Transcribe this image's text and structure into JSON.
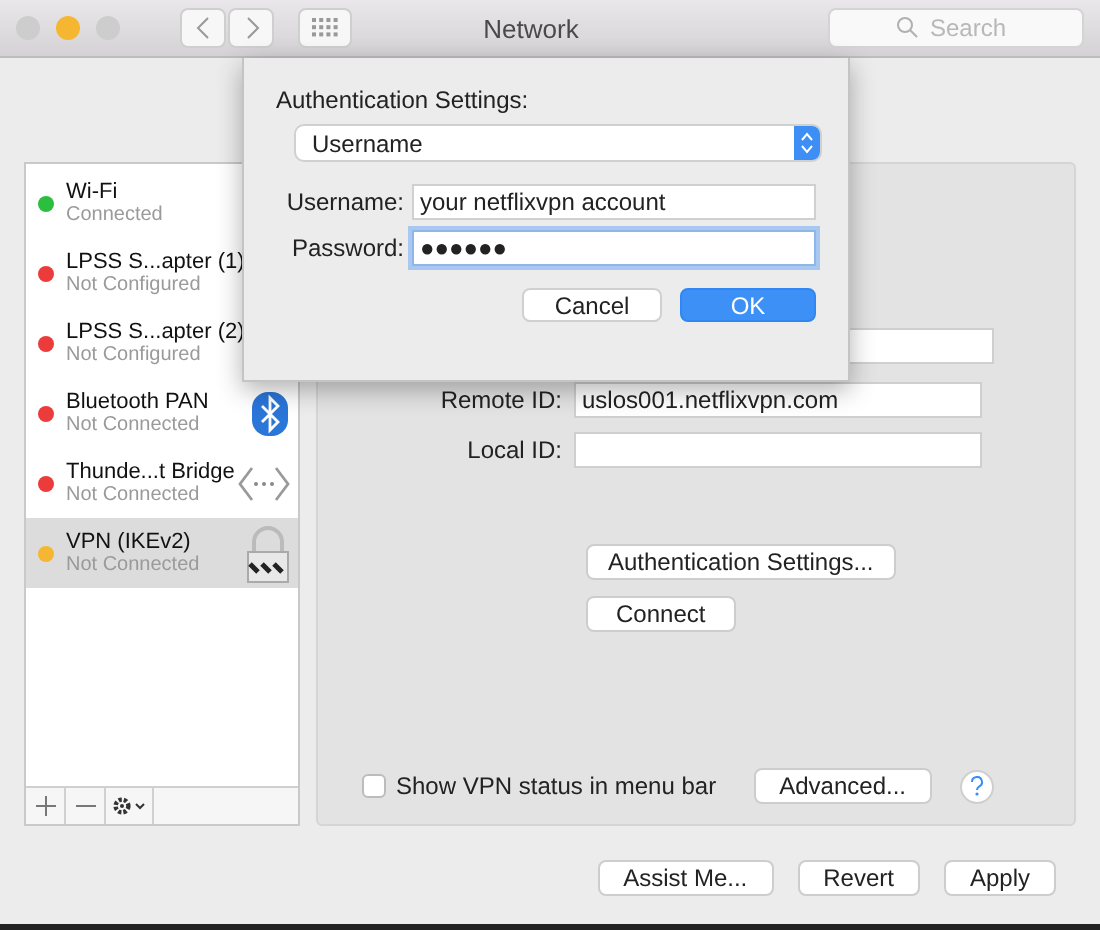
{
  "window": {
    "title": "Network",
    "controls": [
      {
        "color": "#cdcdcd"
      },
      {
        "color": "#f5b731"
      },
      {
        "color": "#cdcdcd"
      }
    ]
  },
  "toolbar": {
    "search": {
      "placeholder": "Search"
    }
  },
  "sidebar": {
    "items": [
      {
        "name": "Wi-Fi",
        "status": "Connected",
        "color": "#2dbd3f",
        "selected": false,
        "kind": "plain"
      },
      {
        "name": "LPSS S...apter (1)",
        "status": "Not Configured",
        "color": "#ec3b3b",
        "selected": false,
        "kind": "plain"
      },
      {
        "name": "LPSS S...apter (2)",
        "status": "Not Configured",
        "color": "#ec3b3b",
        "selected": false,
        "kind": "plain"
      },
      {
        "name": "Bluetooth PAN",
        "status": "Not Connected",
        "color": "#ec3b3b",
        "selected": false,
        "kind": "bluetooth"
      },
      {
        "name": "Thunde...t Bridge",
        "status": "Not Connected",
        "color": "#ec3b3b",
        "selected": false,
        "kind": "bridge"
      },
      {
        "name": "VPN (IKEv2)",
        "status": "Not Connected",
        "color": "#f5b731",
        "selected": true,
        "kind": "vpn"
      }
    ]
  },
  "details": {
    "fields": [
      {
        "label": "Remote ID:",
        "value": "uslos001.netflixvpn.com"
      },
      {
        "label": "Local ID:"
      }
    ],
    "buttons": [
      "Authentication Settings...",
      "Connect"
    ],
    "show_status": {
      "label": "Show VPN status in menu bar",
      "checked": false
    },
    "advanced": "Advanced..."
  },
  "footer_buttons": [
    "Assist Me...",
    "Revert",
    "Apply"
  ],
  "dialog": {
    "title": "Authentication Settings:",
    "method": "Username",
    "fields": [
      {
        "label": "Username:",
        "value": "your netflixvpn account",
        "focused": false
      },
      {
        "label": "Password:",
        "value": "●●●●●●",
        "focused": true
      }
    ],
    "buttons": [
      {
        "label": "Cancel",
        "default": false
      },
      {
        "label": "OK",
        "default": true
      }
    ]
  }
}
